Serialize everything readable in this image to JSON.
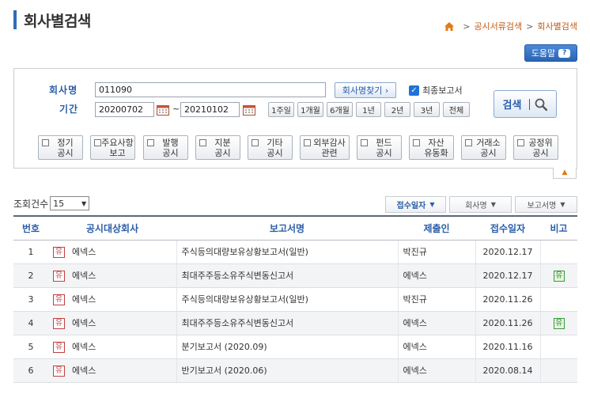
{
  "title": "회사별검색",
  "breadcrumb": {
    "items": [
      "공시서류검색",
      "회사별검색"
    ]
  },
  "help": {
    "label": "도움말",
    "icon": "?"
  },
  "form": {
    "company_label": "회사명",
    "company_value": "011090",
    "company_find_label": "회사명찾기 ›",
    "final_report_label": "최종보고서",
    "period_label": "기간",
    "start_date": "20200702",
    "end_date": "20210102",
    "date_sep": "~",
    "periods": [
      "1주일",
      "1개월",
      "6개월",
      "1년",
      "2년",
      "3년",
      "전체"
    ],
    "search_label": "검색",
    "types": [
      [
        "정기",
        "공시"
      ],
      [
        "주요사항",
        "보고"
      ],
      [
        "발행",
        "공시"
      ],
      [
        "지분",
        "공시"
      ],
      [
        "기타",
        "공시"
      ],
      [
        "외부감사",
        "관련"
      ],
      [
        "펀드",
        "공시"
      ],
      [
        "자산",
        "유동화"
      ],
      [
        "거래소",
        "공시"
      ],
      [
        "공정위",
        "공시"
      ]
    ]
  },
  "count": {
    "label": "조회건수",
    "value": "15"
  },
  "sort": [
    {
      "label": "접수일자",
      "active": true
    },
    {
      "label": "회사명",
      "active": false
    },
    {
      "label": "보고서명",
      "active": false
    }
  ],
  "table": {
    "headers": [
      "번호",
      "공시대상회사",
      "보고서명",
      "제출인",
      "접수일자",
      "비고"
    ],
    "rows": [
      {
        "num": "1",
        "badge": "유",
        "company": "에넥스",
        "report": "주식등의대량보유상황보고서(일반)",
        "submitter": "박진규",
        "date": "2020.12.17",
        "note": ""
      },
      {
        "num": "2",
        "badge": "유",
        "company": "에넥스",
        "report": "최대주주등소유주식변동신고서",
        "submitter": "에넥스",
        "date": "2020.12.17",
        "note": "유"
      },
      {
        "num": "3",
        "badge": "유",
        "company": "에넥스",
        "report": "주식등의대량보유상황보고서(일반)",
        "submitter": "박진규",
        "date": "2020.11.26",
        "note": ""
      },
      {
        "num": "4",
        "badge": "유",
        "company": "에넥스",
        "report": "최대주주등소유주식변동신고서",
        "submitter": "에넥스",
        "date": "2020.11.26",
        "note": "유"
      },
      {
        "num": "5",
        "badge": "유",
        "company": "에넥스",
        "report": "분기보고서 (2020.09)",
        "submitter": "에넥스",
        "date": "2020.11.16",
        "note": ""
      },
      {
        "num": "6",
        "badge": "유",
        "company": "에넥스",
        "report": "반기보고서 (2020.06)",
        "submitter": "에넥스",
        "date": "2020.08.14",
        "note": ""
      }
    ]
  }
}
